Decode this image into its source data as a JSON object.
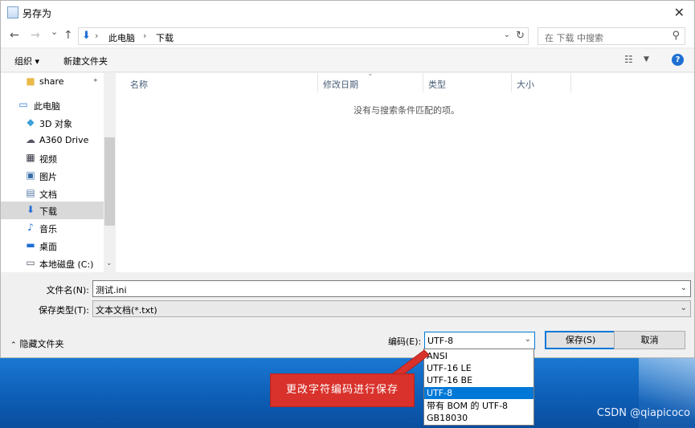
{
  "window": {
    "title": "另存为",
    "close_glyph": "✕"
  },
  "nav": {
    "back_glyph": "←",
    "forward_glyph": "→",
    "recent_glyph": "⌄",
    "up_glyph": "↑",
    "breadcrumb": [
      "此电脑",
      "下载"
    ],
    "search_placeholder": "在 下载 中搜索"
  },
  "toolbar": {
    "organize_label": "组织 ▾",
    "new_folder_label": "新建文件夹"
  },
  "sidebar": {
    "items": [
      {
        "label": "share",
        "icon": "folder-icon",
        "pinned": true
      },
      {
        "label": "此电脑",
        "icon": "computer-icon"
      },
      {
        "label": "3D 对象",
        "icon": "cube-icon"
      },
      {
        "label": "A360 Drive",
        "icon": "cloud-drive-icon"
      },
      {
        "label": "视频",
        "icon": "video-icon"
      },
      {
        "label": "图片",
        "icon": "picture-icon"
      },
      {
        "label": "文档",
        "icon": "document-icon"
      },
      {
        "label": "下载",
        "icon": "download-icon",
        "selected": true
      },
      {
        "label": "音乐",
        "icon": "music-icon"
      },
      {
        "label": "桌面",
        "icon": "desktop-icon"
      },
      {
        "label": "本地磁盘 (C:)",
        "icon": "disk-icon"
      }
    ]
  },
  "filelist": {
    "columns": [
      "名称",
      "修改日期",
      "类型",
      "大小"
    ],
    "empty_message": "没有与搜索条件匹配的项。"
  },
  "form": {
    "filename_label": "文件名(N):",
    "filename_value": "测试.ini",
    "filetype_label": "保存类型(T):",
    "filetype_value": "文本文档(*.txt)"
  },
  "footer": {
    "hide_folders_label": "隐藏文件夹",
    "encoding_label": "编码(E):",
    "encoding_value": "UTF-8",
    "save_label": "保存(S)",
    "cancel_label": "取消"
  },
  "encoding_options": [
    {
      "label": "ANSI"
    },
    {
      "label": "UTF-16 LE"
    },
    {
      "label": "UTF-16 BE"
    },
    {
      "label": "UTF-8",
      "selected": true
    },
    {
      "label": "带有 BOM 的 UTF-8"
    },
    {
      "label": "GB18030"
    }
  ],
  "annotation": {
    "text": "更改字符编码进行保存"
  },
  "watermark": "CSDN @qiapicoco",
  "colors": {
    "accent": "#0078d7",
    "callout": "#d9312b"
  }
}
